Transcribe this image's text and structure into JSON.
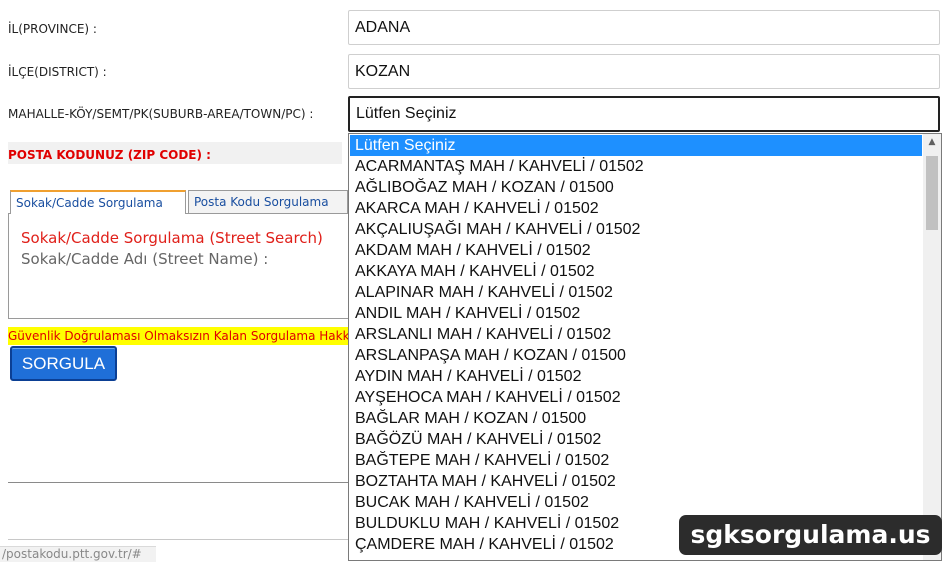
{
  "form": {
    "province_label": "İL(PROVINCE) :",
    "province_value": "ADANA",
    "district_label": "İLÇE(DISTRICT) :",
    "district_value": "KOZAN",
    "suburb_label": "MAHALLE-KÖY/SEMT/PK(SUBURB-AREA/TOWN/PC) :",
    "suburb_value": "Lütfen Seçiniz",
    "zip_label": "POSTA KODUNUZ (ZIP CODE) :"
  },
  "tabs": [
    {
      "label": "Sokak/Cadde Sorgulama",
      "active": true
    },
    {
      "label": "Posta Kodu Sorgulama",
      "active": false
    }
  ],
  "panel": {
    "title": "Sokak/Cadde Sorgulama (Street Search)",
    "subtitle": "Sokak/Cadde Adı (Street Name) :"
  },
  "warning_text": "Güvenlik Doğrulaması Olmaksızın Kalan Sorgulama Hakkınız",
  "query_button": "SORGULA",
  "url_fragment": "/postakodu.ptt.gov.tr/#",
  "dropdown": {
    "selected_index": 0,
    "options": [
      "Lütfen Seçiniz",
      "ACARMANTAŞ MAH / KAHVELİ / 01502",
      "AĞLIBOĞAZ MAH / KOZAN / 01500",
      "AKARCA MAH / KAHVELİ / 01502",
      "AKÇALIUŞAĞI MAH / KAHVELİ / 01502",
      "AKDAM MAH / KAHVELİ / 01502",
      "AKKAYA MAH / KAHVELİ / 01502",
      "ALAPINAR MAH / KAHVELİ / 01502",
      "ANDIL MAH / KAHVELİ / 01502",
      "ARSLANLI MAH / KAHVELİ / 01502",
      "ARSLANPAŞA MAH / KOZAN / 01500",
      "AYDIN MAH / KAHVELİ / 01502",
      "AYŞEHOCA MAH / KAHVELİ / 01502",
      "BAĞLAR MAH / KOZAN / 01500",
      "BAĞÖZÜ MAH / KAHVELİ / 01502",
      "BAĞTEPE MAH / KAHVELİ / 01502",
      "BOZTAHTA MAH / KAHVELİ / 01502",
      "BUCAK MAH / KAHVELİ / 01502",
      "BULDUKLU MAH / KAHVELİ / 01502",
      "ÇAMDERE MAH / KAHVELİ / 01502"
    ],
    "scroll_position": 0
  },
  "watermark": "sgksorgulama.us",
  "colors": {
    "selected_option_bg": "#1e90ff",
    "button_bg": "#1f6fd8",
    "warning_bg": "#ffff00",
    "alert_red": "#e00000"
  },
  "icons": {
    "scroll_up": "triangle-up"
  }
}
